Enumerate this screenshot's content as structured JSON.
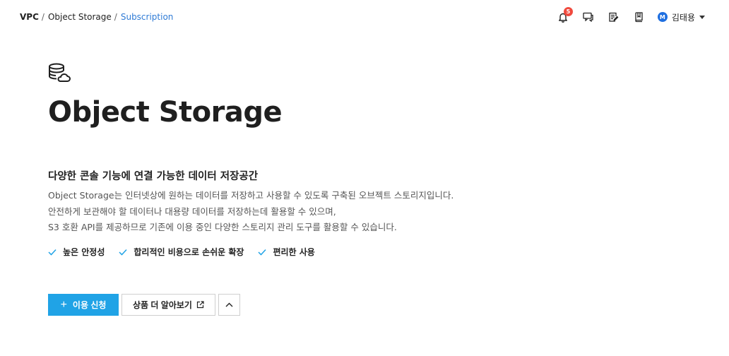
{
  "breadcrumb": {
    "items": [
      "VPC",
      "Object Storage",
      "Subscription"
    ],
    "separator": "/"
  },
  "header": {
    "notifications": {
      "icon": "bell-icon",
      "count": "5"
    },
    "icons": [
      "bell-icon",
      "chat-icon",
      "notepad-icon",
      "book-icon"
    ],
    "user": {
      "avatar_letter": "M",
      "name": "김태용",
      "avatar_color": "#1f6fe0"
    }
  },
  "main": {
    "icon": "database-cloud-icon",
    "title": "Object Storage",
    "subtitle": "다양한 콘솔 기능에 연결 가능한 데이터 저장공간",
    "description": [
      "Object Storage는 인터넷상에 원하는 데이터를 저장하고 사용할 수 있도록 구축된 오브젝트 스토리지입니다.",
      "안전하게 보관해야 할 데이터나 대용량 데이터를 저장하는데 활용할 수 있으며,",
      "S3 호환 API를 제공하므로 기존에 이용 중인 다양한 스토리지 관리 도구를 활용할 수 있습니다."
    ],
    "features": [
      "높은 안정성",
      "합리적인 비용으로 손쉬운 확장",
      "편리한 사용"
    ],
    "actions": {
      "apply_label": "이용 신청",
      "learn_more_label": "상품 더 알아보기"
    }
  },
  "colors": {
    "accent": "#20a3e6",
    "link": "#2f7bd6",
    "badge": "#f04a3e",
    "check": "#20a3e6"
  }
}
